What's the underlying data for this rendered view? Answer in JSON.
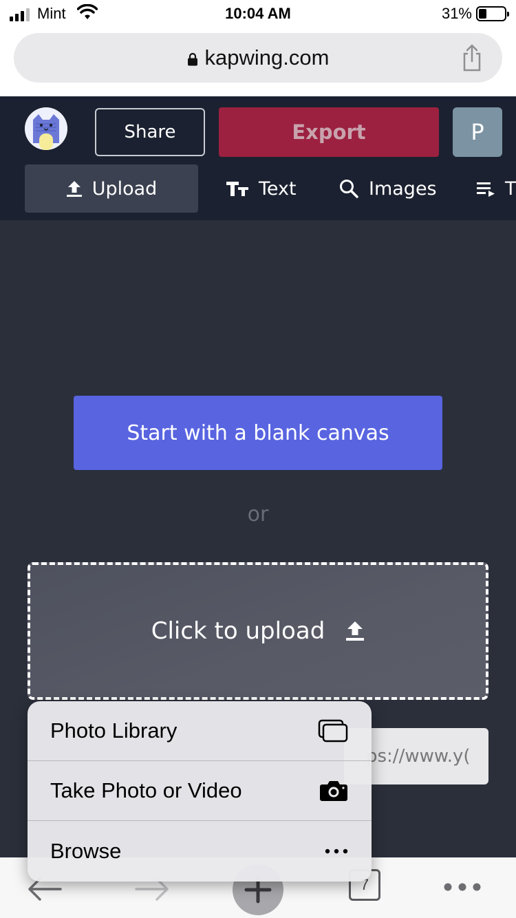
{
  "status_bar": {
    "carrier": "Mint",
    "time": "10:04 AM",
    "battery_percent": "31%",
    "battery_level": 0.31,
    "signal_bars": 3
  },
  "browser": {
    "url": "kapwing.com"
  },
  "app": {
    "share_label": "Share",
    "export_label": "Export",
    "avatar_initial": "P",
    "colors": {
      "header_bg": "#1b2130",
      "export": "#9c2140",
      "blank_canvas": "#5864e0",
      "avatar": "#7b93a3"
    },
    "toolbar": [
      {
        "label": "Upload",
        "icon": "upload-icon",
        "active": true
      },
      {
        "label": "Text",
        "icon": "text-icon"
      },
      {
        "label": "Images",
        "icon": "search-icon"
      },
      {
        "label": "T",
        "icon": "playlist-icon"
      }
    ]
  },
  "main": {
    "blank_canvas_label": "Start with a blank canvas",
    "or_text": "or",
    "upload_label": "Click to upload",
    "url_input_value": "ps://www.y("
  },
  "popover": {
    "items": [
      {
        "label": "Photo Library",
        "icon": "photo-library-icon"
      },
      {
        "label": "Take Photo or Video",
        "icon": "camera-icon"
      },
      {
        "label": "Browse",
        "icon": "more-icon"
      }
    ]
  },
  "bottom_bar": {
    "tab_count": "7"
  }
}
